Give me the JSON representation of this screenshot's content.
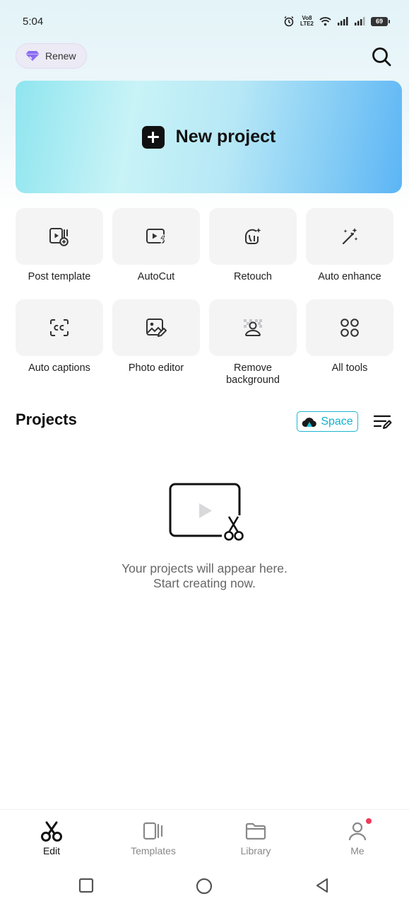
{
  "status_bar": {
    "time": "5:04",
    "volte_top": "Vo8",
    "volte_bottom": "LTE2",
    "battery": "69"
  },
  "header": {
    "renew_label": "Renew"
  },
  "banner": {
    "label": "New project"
  },
  "tools": [
    {
      "label": "Post template",
      "icon": "post-template-icon"
    },
    {
      "label": "AutoCut",
      "icon": "autocut-icon"
    },
    {
      "label": "Retouch",
      "icon": "retouch-icon"
    },
    {
      "label": "Auto enhance",
      "icon": "magic-wand-icon"
    },
    {
      "label": "Auto captions",
      "icon": "captions-icon"
    },
    {
      "label": "Photo editor",
      "icon": "photo-edit-icon"
    },
    {
      "label": "Remove background",
      "icon": "remove-background-icon"
    },
    {
      "label": "All tools",
      "icon": "grid-icon"
    }
  ],
  "projects": {
    "title": "Projects",
    "space_label": "Space",
    "empty_line1": "Your projects will appear here.",
    "empty_line2": "Start creating now."
  },
  "bottom_nav": [
    {
      "label": "Edit",
      "icon": "scissors-icon",
      "active": true
    },
    {
      "label": "Templates",
      "icon": "templates-icon",
      "active": false
    },
    {
      "label": "Library",
      "icon": "folder-icon",
      "active": false
    },
    {
      "label": "Me",
      "icon": "person-icon",
      "active": false
    }
  ],
  "colors": {
    "accent": "#13b2cd",
    "notify": "#f03a5a",
    "renew_gem": "#8a6cf0"
  }
}
